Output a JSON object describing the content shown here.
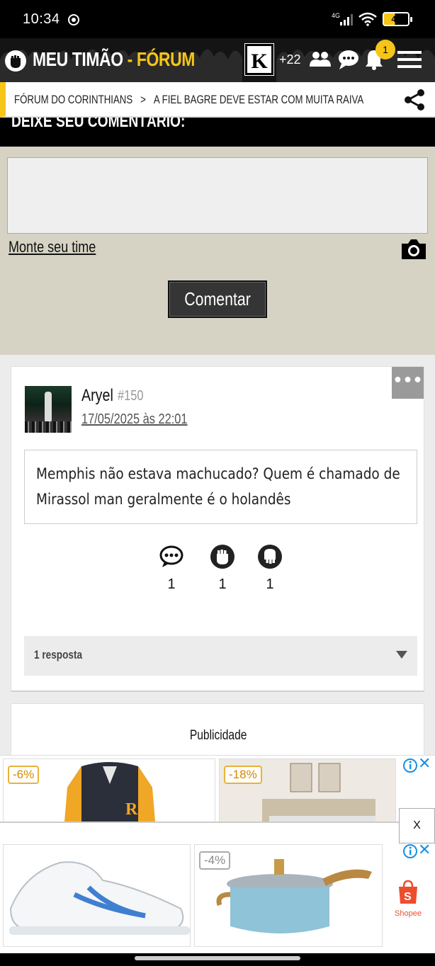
{
  "status_bar": {
    "time": "10:34",
    "network": "4G",
    "battery": "46"
  },
  "header": {
    "brand_main": "MEU TIMÃO",
    "brand_dash": " - ",
    "brand_forum": "FÓRUM",
    "k_logo": "K",
    "followers": "+22",
    "notifications": "1"
  },
  "breadcrumb": {
    "root": "FÓRUM DO CORINTHIANS",
    "separator": ">",
    "current": "A FIEL BAGRE DEVE ESTAR COM MUITA RAIVA"
  },
  "comment_form": {
    "title": "DEIXE SEU COMENTÁRIO:",
    "input_value": "",
    "team_link": "Monte seu time",
    "submit": "Comentar"
  },
  "post": {
    "more": "•••",
    "author": "Aryel",
    "number": "#150",
    "date": "17/05/2025 às 22:01",
    "body_line1": "Memphis não estava machucado? Quem é chamado de",
    "body_line2": "Mirassol man geralmente é o holandês",
    "reactions": {
      "comments": "1",
      "up": "1",
      "down": "1"
    },
    "replies": "1 resposta"
  },
  "ads": {
    "label": "Publicidade",
    "discount_1": "-6%",
    "discount_2": "-18%",
    "discount_3": "-4%",
    "close_label": "X",
    "close_x": "✕",
    "shopee_label": "Shopee"
  },
  "colors": {
    "accent": "#f5c518",
    "header_bg": "#141414",
    "form_bg": "#d7d3c4"
  }
}
